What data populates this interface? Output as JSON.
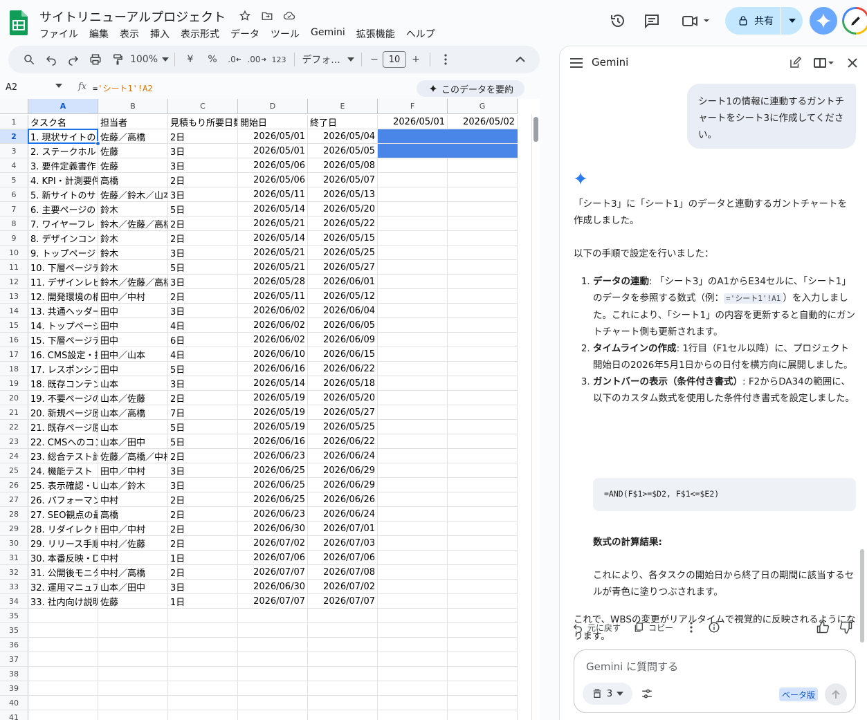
{
  "app": {
    "title": "サイトリニューアルプロジェクト",
    "menu": [
      "ファイル",
      "編集",
      "表示",
      "挿入",
      "表示形式",
      "データ",
      "ツール",
      "Gemini",
      "拡張機能",
      "ヘルプ"
    ],
    "share_label": "共有"
  },
  "toolbar": {
    "zoom": "100%",
    "currency": "¥",
    "percent": "%",
    "dec_less": ".0",
    "dec_more": ".00",
    "number_format": "123",
    "font": "デフォ...",
    "font_size": "10",
    "minus": "−",
    "plus": "+"
  },
  "formula_bar": {
    "cell_ref": "A2",
    "fx": "fx",
    "formula_eq": "=",
    "formula_ref": "'シート1'!A2",
    "summarize_label": "このデータを要約"
  },
  "sheet": {
    "columns": [
      "A",
      "B",
      "C",
      "D",
      "E",
      "F",
      "G"
    ],
    "header_row": [
      "タスク名",
      "担当者",
      "見積もり所要日数",
      "開始日",
      "終了日",
      "2026/05/01",
      "2026/05/02"
    ],
    "rows": [
      [
        "1. 現状サイトの",
        "佐藤／高橋",
        "2日",
        "2026/05/01",
        "2026/05/04"
      ],
      [
        "2. ステークホル",
        "佐藤",
        "3日",
        "2026/05/01",
        "2026/05/05"
      ],
      [
        "3. 要件定義書作",
        "佐藤",
        "3日",
        "2026/05/06",
        "2026/05/08"
      ],
      [
        "4. KPI・計測要件",
        "高橋",
        "2日",
        "2026/05/06",
        "2026/05/07"
      ],
      [
        "5. 新サイトのサ",
        "佐藤／鈴木／山本",
        "3日",
        "2026/05/11",
        "2026/05/13"
      ],
      [
        "6. 主要ページの",
        "鈴木",
        "5日",
        "2026/05/14",
        "2026/05/20"
      ],
      [
        "7. ワイヤーフレ",
        "鈴木／佐藤／高橋",
        "2日",
        "2026/05/21",
        "2026/05/22"
      ],
      [
        "8. デザインコン",
        "鈴木",
        "2日",
        "2026/05/14",
        "2026/05/15"
      ],
      [
        "9. トップページ",
        "鈴木",
        "3日",
        "2026/05/21",
        "2026/05/25"
      ],
      [
        "10. 下層ページデ",
        "鈴木",
        "5日",
        "2026/05/21",
        "2026/05/27"
      ],
      [
        "11. デザインレビ",
        "鈴木／佐藤／高橋",
        "3日",
        "2026/05/28",
        "2026/06/01"
      ],
      [
        "12. 開発環境の構",
        "田中／中村",
        "2日",
        "2026/05/11",
        "2026/05/12"
      ],
      [
        "13. 共通ヘッダー",
        "田中",
        "3日",
        "2026/06/02",
        "2026/06/04"
      ],
      [
        "14. トップページ",
        "田中",
        "4日",
        "2026/06/02",
        "2026/06/05"
      ],
      [
        "15. 下層ページテ",
        "田中",
        "6日",
        "2026/06/02",
        "2026/06/09"
      ],
      [
        "16. CMS設定・投",
        "田中／山本",
        "4日",
        "2026/06/10",
        "2026/06/15"
      ],
      [
        "17. レスポンシブ",
        "田中",
        "5日",
        "2026/06/16",
        "2026/06/22"
      ],
      [
        "18. 既存コンテン",
        "山本",
        "3日",
        "2026/05/14",
        "2026/05/18"
      ],
      [
        "19. 不要ページの",
        "山本／佐藤",
        "2日",
        "2026/05/19",
        "2026/05/20"
      ],
      [
        "20. 新規ページ原",
        "山本／高橋",
        "7日",
        "2026/05/19",
        "2026/05/27"
      ],
      [
        "21. 既存ページ原",
        "山本",
        "5日",
        "2026/05/19",
        "2026/05/25"
      ],
      [
        "22. CMSへのコン",
        "山本／田中",
        "5日",
        "2026/06/16",
        "2026/06/22"
      ],
      [
        "23. 総合テスト計",
        "佐藤／高橋／中村",
        "2日",
        "2026/06/23",
        "2026/06/24"
      ],
      [
        "24. 機能テスト",
        "田中／中村",
        "3日",
        "2026/06/25",
        "2026/06/29"
      ],
      [
        "25. 表示確認・U",
        "山本／鈴木",
        "3日",
        "2026/06/25",
        "2026/06/29"
      ],
      [
        "26. パフォーマン",
        "中村",
        "2日",
        "2026/06/25",
        "2026/06/26"
      ],
      [
        "27. SEO観点の最",
        "高橋",
        "2日",
        "2026/06/23",
        "2026/06/24"
      ],
      [
        "28. リダイレクト",
        "田中／中村",
        "2日",
        "2026/06/30",
        "2026/07/01"
      ],
      [
        "29. リリース手順",
        "中村／佐藤",
        "2日",
        "2026/07/02",
        "2026/07/03"
      ],
      [
        "30. 本番反映・D",
        "中村",
        "1日",
        "2026/07/06",
        "2026/07/06"
      ],
      [
        "31. 公開後モニタ",
        "中村／高橋",
        "2日",
        "2026/07/07",
        "2026/07/08"
      ],
      [
        "32. 運用マニュア",
        "山本／田中",
        "3日",
        "2026/06/30",
        "2026/07/02"
      ],
      [
        "33. 社内向け説明",
        "佐藤",
        "1日",
        "2026/07/07",
        "2026/07/07"
      ]
    ],
    "empty_row_numbers": [
      35,
      36,
      37,
      38,
      39,
      40,
      41,
      42
    ]
  },
  "gemini": {
    "title": "Gemini",
    "user_message": "シート1の情報に連動するガントチャートをシート3に作成してください。",
    "intro": "「シート3」に「シート1」のデータと連動するガントチャートを作成しました。",
    "steps_intro": "以下の手順で設定を行いました：",
    "step1_title": "データの連動",
    "step1_a": ": 「シート3」のA1からE34セルに、「シート1」のデータを参照する数式（例：",
    "step1_code": "='シート1'!A1",
    "step1_b": "）を入力しました。これにより、「シート1」の内容を更新すると自動的にガントチャート側も更新されます。",
    "step2_title": "タイムラインの作成",
    "step2_text": ": 1行目（F1セル以降）に、プロジェクト開始日の2026年5月1日からの日付を横方向に展開しました。",
    "step3_title": "ガントバーの表示（条件付き書式）",
    "step3_text": ": F2からDA34の範囲に、以下のカスタム数式を使用した条件付き書式を設定しました。",
    "code_block": "=AND(F$1>=$D2, F$1<=$E2)",
    "result_title": "数式の計算結果:",
    "result_text": "これにより、各タスクの開始日から終了日の期間に該当するセルが青色に塗りつぶされます。",
    "closing": "これで、WBSの変更がリアルタイムで視覚的に反映されるようになります。",
    "undo_label": "元に戻す",
    "copy_label": "コピー",
    "input_placeholder": "Gemini に質問する",
    "chip_count": "3",
    "beta_label": "ベータ版"
  },
  "colors": {
    "gantt_fill": "#4a86e8",
    "selection": "#1a73e8",
    "share_bg": "#c2e7ff"
  }
}
